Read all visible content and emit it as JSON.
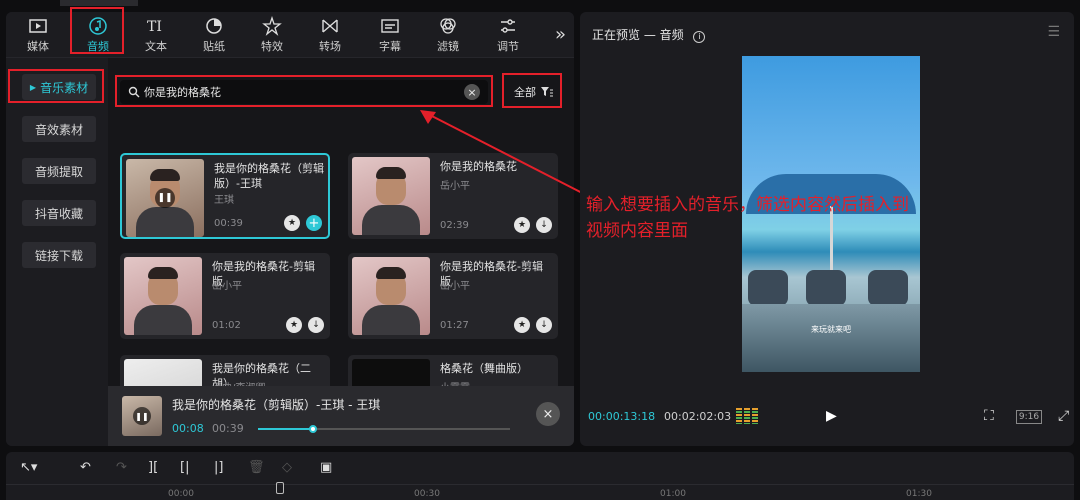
{
  "toolbar": {
    "items": [
      {
        "label": "媒体",
        "icon": "media-icon"
      },
      {
        "label": "音频",
        "icon": "audio-icon"
      },
      {
        "label": "文本",
        "icon": "text-icon"
      },
      {
        "label": "贴纸",
        "icon": "sticker-icon"
      },
      {
        "label": "特效",
        "icon": "effects-icon"
      },
      {
        "label": "转场",
        "icon": "transition-icon"
      },
      {
        "label": "字幕",
        "icon": "caption-icon"
      },
      {
        "label": "滤镜",
        "icon": "filter-icon"
      },
      {
        "label": "调节",
        "icon": "adjust-icon"
      }
    ],
    "active": "音频",
    "more": "»"
  },
  "sidebar": {
    "items": [
      {
        "label": "音乐素材",
        "active": true
      },
      {
        "label": "音效素材"
      },
      {
        "label": "音频提取"
      },
      {
        "label": "抖音收藏"
      },
      {
        "label": "链接下载"
      }
    ]
  },
  "search": {
    "value": "你是我的格桑花",
    "clear": "×"
  },
  "filter": {
    "label": "全部"
  },
  "results": [
    {
      "title": "我是你的格桑花（剪辑版）-王琪",
      "artist": "王琪",
      "duration": "00:39",
      "selected": true
    },
    {
      "title": "你是我的格桑花",
      "artist": "岳小平",
      "duration": "02:39"
    },
    {
      "title": "你是我的格桑花-剪辑版",
      "artist": "岳小平",
      "duration": "01:02"
    },
    {
      "title": "你是我的格桑花-剪辑版",
      "artist": "岳小平",
      "duration": "01:27"
    },
    {
      "title": "我是你的格桑花（二胡）",
      "artist": "潘曲/李淑卿",
      "duration": ""
    },
    {
      "title": "格桑花（舞曲版）",
      "artist": "小霍霍",
      "duration": ""
    }
  ],
  "player": {
    "title": "我是你的格桑花（剪辑版）-王琪 - 王琪",
    "current": "00:08",
    "total": "00:39",
    "progress": 0.22
  },
  "preview": {
    "header": "正在预览 — 音频",
    "subtitle": "来玩就来吧",
    "current_time": "00:00:13:18",
    "total_time": "00:02:02:03",
    "ratio": "9:16"
  },
  "annotation": {
    "text": "输入想要插入的音乐，筛选内容然后插入到视频内容里面"
  },
  "timeline": {
    "ticks": [
      "00:00",
      "00:30",
      "01:00",
      "01:30"
    ]
  },
  "colors": {
    "accent": "#2ec8d6",
    "annotation_red": "#e4202a",
    "panel": "#1c1c20"
  }
}
